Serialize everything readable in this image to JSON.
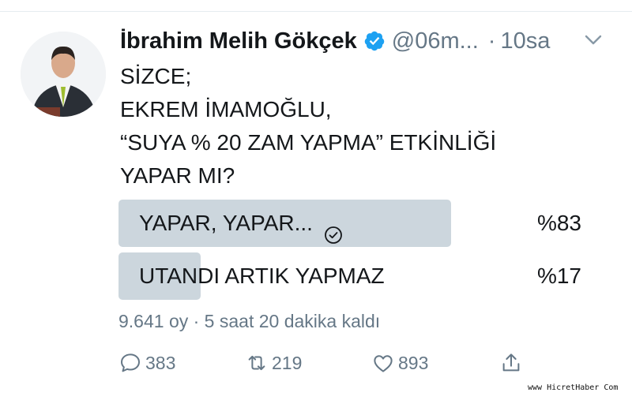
{
  "tweet": {
    "author_name": "İbrahim Melih Gökçek",
    "handle": "@06m...",
    "separator": "·",
    "time": "10sa",
    "lines": [
      "SİZCE;",
      "EKREM İMAMOĞLU,",
      "“SUYA % 20 ZAM YAPMA” ETKİNLİĞİ",
      "YAPAR MI?"
    ]
  },
  "poll": {
    "options": [
      {
        "label": "YAPAR, YAPAR...",
        "percent_label": "%83",
        "fraction": 0.83,
        "selected": true
      },
      {
        "label": "UTANDI ARTIK YAPMAZ",
        "percent_label": "%17",
        "fraction": 0.17,
        "selected": false
      }
    ],
    "meta": "9.641 oy · 5 saat 20 dakika kaldı"
  },
  "actions": {
    "replies": "383",
    "retweets": "219",
    "likes": "893"
  },
  "watermark": "www HicretHaber Com",
  "colors": {
    "text": "#14171a",
    "muted": "#657786",
    "bar": "#ccd6dd",
    "verified": "#1da1f2"
  },
  "icons": [
    "verified-badge-icon",
    "chevron-down-icon",
    "check-circle-icon",
    "reply-icon",
    "retweet-icon",
    "like-icon",
    "share-icon"
  ]
}
